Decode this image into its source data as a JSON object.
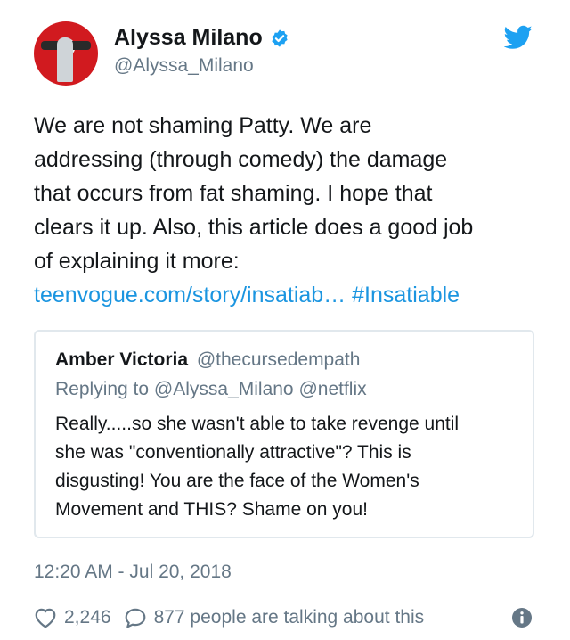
{
  "author": {
    "name": "Alyssa Milano",
    "handle": "@Alyssa_Milano",
    "verified": true
  },
  "tweet": {
    "text_line1": "We are not shaming Patty.  We are",
    "text_line2": "addressing (through comedy) the damage",
    "text_line3": "that occurs from fat shaming. I hope that",
    "text_line4": "clears it up. Also, this article does a good job",
    "text_line5": "of explaining it more:",
    "link": "teenvogue.com/story/insatiab…",
    "hashtag": "#Insatiable"
  },
  "quoted_tweet": {
    "name": "Amber Victoria",
    "handle": "@thecursedempath",
    "replying_to": "Replying to @Alyssa_Milano @netflix",
    "text_line1": "Really.....so she wasn't able to take revenge until",
    "text_line2": "she was \"conventionally attractive\"? This is",
    "text_line3": "disgusting! You are the face of the Women's",
    "text_line4": "Movement and THIS? Shame on you!"
  },
  "timestamp": "12:20 AM - Jul 20, 2018",
  "engagement": {
    "likes": "2,246",
    "talking": "877 people are talking about this"
  },
  "colors": {
    "link": "#1b95e0",
    "secondary": "#657786",
    "border": "#e1e8ed",
    "twitter_blue": "#1da1f2"
  },
  "icons": [
    "twitter-bird-icon",
    "verified-badge-icon",
    "heart-icon",
    "reply-bubble-icon",
    "info-icon"
  ]
}
